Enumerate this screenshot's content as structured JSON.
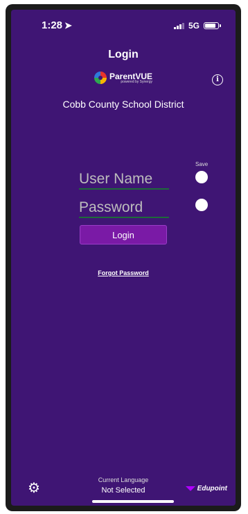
{
  "status_bar": {
    "time": "1:28",
    "network": "5G"
  },
  "header": {
    "title": "Login"
  },
  "brand": {
    "name": "ParentVUE",
    "tagline": "powered by Synergy"
  },
  "district": "Cobb County School District",
  "form": {
    "save_label": "Save",
    "username_placeholder": "User Name",
    "password_placeholder": "Password",
    "login_label": "Login",
    "forgot_label": "Forgot Password"
  },
  "footer": {
    "language_label": "Current Language",
    "language_value": "Not Selected",
    "vendor": "Edupoint"
  },
  "colors": {
    "background": "#3f1574",
    "button": "#7a1aa6",
    "accent_arrow": "#b000ff",
    "underline": "#1e6b3a"
  }
}
